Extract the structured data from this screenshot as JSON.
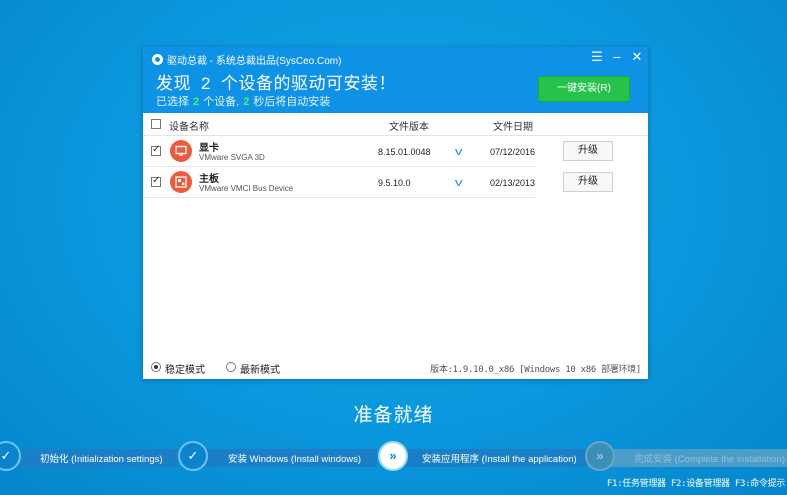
{
  "window": {
    "title": "驱动总裁 - 系统总裁出品(SysCeo.Com)",
    "controls": {
      "menu": "☰",
      "minimize": "–",
      "close": "✕"
    },
    "headline": {
      "prefix": "发现",
      "count": "2",
      "suffix": "个设备的驱动可安装！"
    },
    "subline": {
      "p1": "已选择",
      "selected": "2",
      "p2": "个设备,",
      "seconds": "2",
      "p3": "秒后将自动安装"
    },
    "install_button": "一键安装(R)",
    "columns": {
      "name": "设备名称",
      "version": "文件版本",
      "date": "文件日期"
    },
    "devices": [
      {
        "name": "显卡",
        "detail": "VMware SVGA 3D",
        "version": "8.15.01.0048",
        "date": "07/12/2016",
        "action": "升级",
        "checked": true,
        "icon": "monitor-icon"
      },
      {
        "name": "主板",
        "detail": "VMware VMCI Bus Device",
        "version": "9.5.10.0",
        "date": "02/13/2013",
        "action": "升级",
        "checked": true,
        "icon": "motherboard-icon"
      }
    ],
    "modes": [
      {
        "label": "稳定模式",
        "selected": true
      },
      {
        "label": "最新模式",
        "selected": false
      }
    ],
    "version_info": "版本:1.9.10.0_x86 [Windows 10 x86 部署环境]"
  },
  "status": "准备就绪",
  "steps": [
    {
      "label": "初始化 (Initialization settings)",
      "state": "done"
    },
    {
      "label": "安装 Windows (Install windows)",
      "state": "done"
    },
    {
      "label": "安装应用程序 (Install the application)",
      "state": "current"
    },
    {
      "label": "完成安装 (Complete the installation)",
      "state": "pending"
    }
  ],
  "function_keys": "F1:任务管理器 F2:设备管理器 F3:命令提示",
  "colors": {
    "background": "#0a97dd",
    "header": "#0d92e6",
    "install_button": "#27c24c",
    "device_icon": "#ee5a3b"
  }
}
